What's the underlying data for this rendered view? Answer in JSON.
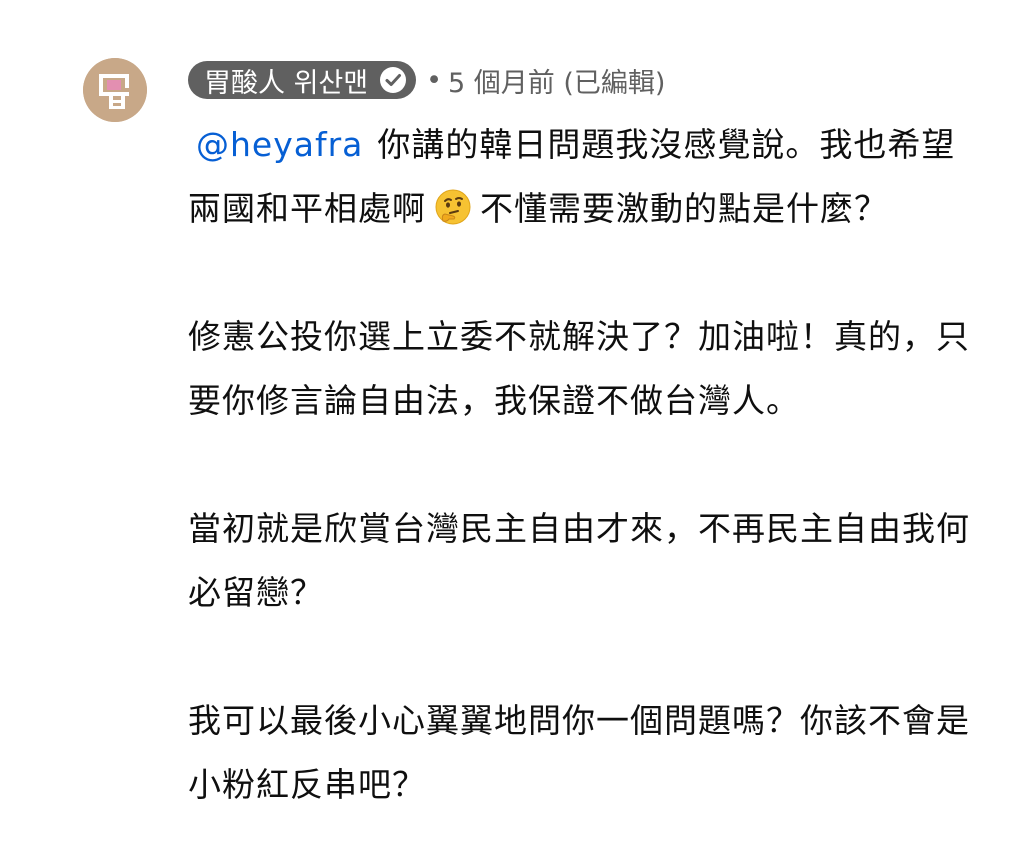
{
  "comment": {
    "author": "胃酸人 위산맨",
    "separator": "•",
    "timestamp": "5 個月前 (已編輯)",
    "mention": "@heyafra",
    "paragraphs": [
      {
        "before_emoji": "你講的韓日問題我沒感覺說。我也希望兩國和平相處啊",
        "emoji": "thinking-face-icon",
        "after_emoji": "不懂需要激動的點是什麼？"
      },
      {
        "text": "修憲公投你選上立委不就解決了？加油啦！真的，只要你修言論自由法，我保證不做台灣人。"
      },
      {
        "text": "當初就是欣賞台灣民主自由才來，不再民主自由我何必留戀？"
      },
      {
        "text": "我可以最後小心翼翼地問你一個問題嗎？你該不會是小粉紅反串吧？"
      }
    ]
  },
  "icons": {
    "avatar": "avatar-logo",
    "verified": "verified-check-icon"
  },
  "colors": {
    "chip_bg": "#606060",
    "mention": "#065fd4",
    "text": "#0f0f0f",
    "meta": "#606060",
    "avatar_bg": "#c8a888"
  }
}
